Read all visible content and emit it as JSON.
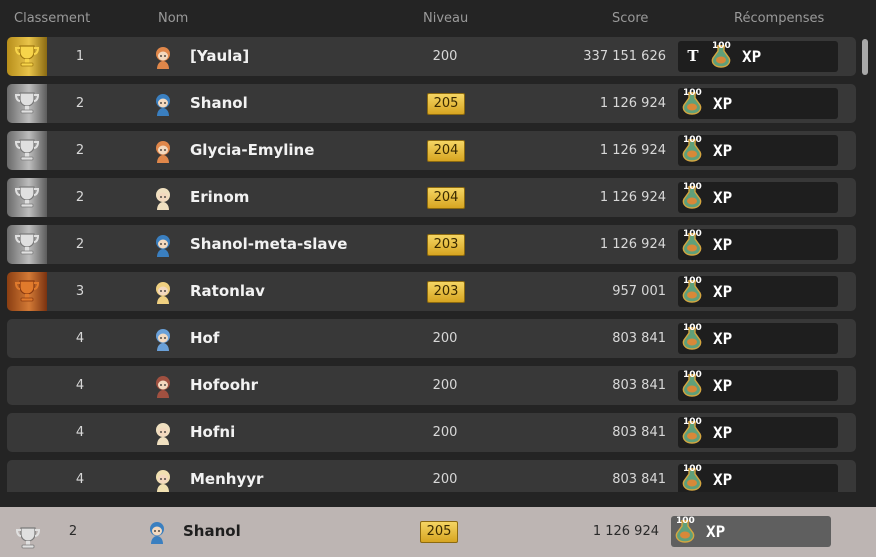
{
  "header": {
    "rank": "Classement",
    "name": "Nom",
    "level": "Niveau",
    "score": "Score",
    "rewards": "Récompenses"
  },
  "rows": [
    {
      "trophy": "gold",
      "rank": "1",
      "name": "[Yaula]",
      "level": "200",
      "badge": false,
      "score": "337 151 626",
      "title_reward": "T",
      "xp_amount": "100",
      "xp_label": "XP",
      "avatar_color": "#e0874a"
    },
    {
      "trophy": "silver",
      "rank": "2",
      "name": "Shanol",
      "level": "205",
      "badge": true,
      "score": "1 126 924",
      "title_reward": "",
      "xp_amount": "100",
      "xp_label": "XP",
      "avatar_color": "#3a7fc0"
    },
    {
      "trophy": "silver",
      "rank": "2",
      "name": "Glycia-Emyline",
      "level": "204",
      "badge": true,
      "score": "1 126 924",
      "title_reward": "",
      "xp_amount": "100",
      "xp_label": "XP",
      "avatar_color": "#e0874a"
    },
    {
      "trophy": "silver",
      "rank": "2",
      "name": "Erinom",
      "level": "204",
      "badge": true,
      "score": "1 126 924",
      "title_reward": "",
      "xp_amount": "100",
      "xp_label": "XP",
      "avatar_color": "#f0e0c0"
    },
    {
      "trophy": "silver",
      "rank": "2",
      "name": "Shanol-meta-slave",
      "level": "203",
      "badge": true,
      "score": "1 126 924",
      "title_reward": "",
      "xp_amount": "100",
      "xp_label": "XP",
      "avatar_color": "#3a7fc0"
    },
    {
      "trophy": "bronze",
      "rank": "3",
      "name": "Ratonlav",
      "level": "203",
      "badge": true,
      "score": "957 001",
      "title_reward": "",
      "xp_amount": "100",
      "xp_label": "XP",
      "avatar_color": "#f0d080"
    },
    {
      "trophy": "none",
      "rank": "4",
      "name": "Hof",
      "level": "200",
      "badge": false,
      "score": "803 841",
      "title_reward": "",
      "xp_amount": "100",
      "xp_label": "XP",
      "avatar_color": "#6aa0d8"
    },
    {
      "trophy": "none",
      "rank": "4",
      "name": "Hofoohr",
      "level": "200",
      "badge": false,
      "score": "803 841",
      "title_reward": "",
      "xp_amount": "100",
      "xp_label": "XP",
      "avatar_color": "#a05040"
    },
    {
      "trophy": "none",
      "rank": "4",
      "name": "Hofni",
      "level": "200",
      "badge": false,
      "score": "803 841",
      "title_reward": "",
      "xp_amount": "100",
      "xp_label": "XP",
      "avatar_color": "#f0e0c0"
    },
    {
      "trophy": "none",
      "rank": "4",
      "name": "Menhyyr",
      "level": "200",
      "badge": false,
      "score": "803 841",
      "title_reward": "",
      "xp_amount": "100",
      "xp_label": "XP",
      "avatar_color": "#f0e0b0"
    }
  ],
  "current_player": {
    "trophy": "silver",
    "rank": "2",
    "name": "Shanol",
    "level": "205",
    "badge": true,
    "score": "1 126 924",
    "xp_amount": "100",
    "xp_label": "XP",
    "avatar_color": "#3a7fc0"
  },
  "colors": {
    "gold": "#e9c44a",
    "silver": "#bdbdbd",
    "bronze": "#d37a36",
    "level_badge": "#f5d563"
  },
  "icons": {
    "trophy": "trophy-icon",
    "avatar": "character-avatar-icon",
    "xp": "xp-potion-icon",
    "title": "title-reward-icon"
  }
}
